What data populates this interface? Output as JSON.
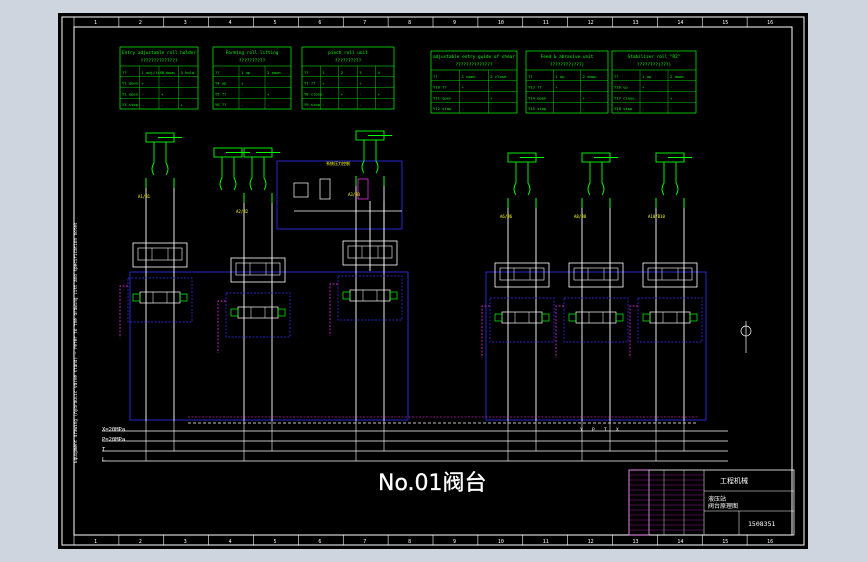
{
  "drawing": {
    "title": "No.01阀台",
    "ruler_numbers": [
      "1",
      "2",
      "3",
      "4",
      "5",
      "6",
      "7",
      "8",
      "9",
      "10",
      "11",
      "12",
      "13",
      "14",
      "15",
      "16"
    ],
    "side_note": "Equipment drawing (hydraulic valve stand) — refer to the drawing list and specification notes",
    "title_block": {
      "company": "工程机械",
      "drawing_no": "1508351",
      "name_lines": [
        "液压站",
        "阀台原理图"
      ]
    }
  },
  "tables": [
    {
      "title": "Entry adjustable roll holder",
      "subtitle": "??????????????",
      "rows": [
        [
          "??",
          "1 adj/lift",
          "2 down",
          "3 hold"
        ],
        [
          "Y1 down",
          "+",
          "-",
          "-"
        ],
        [
          "Y2 open",
          "-",
          "+",
          "-"
        ],
        [
          "Y3 stop",
          "-",
          "-",
          "+"
        ]
      ]
    },
    {
      "title": "Forming roll lifting",
      "subtitle": "??????????",
      "rows": [
        [
          "??",
          "1 up",
          "2 down"
        ],
        [
          "Y4 up",
          "+",
          "-"
        ],
        [
          "Y5 ??",
          "-",
          "+"
        ],
        [
          "Y6 ??",
          "-",
          "-"
        ]
      ]
    },
    {
      "title": "pinch roll unit",
      "subtitle": "??????????",
      "rows": [
        [
          "??",
          "1",
          "2",
          "3",
          "4"
        ],
        [
          "Y7 ??",
          "+",
          "-",
          "+",
          "-"
        ],
        [
          "Y8 close",
          "-",
          "+",
          "-",
          "+"
        ],
        [
          "Y9 stop",
          "-",
          "-",
          "-",
          "-"
        ]
      ]
    },
    {
      "title": "adjustable entry guide of shear",
      "subtitle": "??????????????",
      "rows": [
        [
          "??",
          "1 open",
          "2 close"
        ],
        [
          "Y10 ??",
          "+",
          "-"
        ],
        [
          "Y11 open",
          "-",
          "+"
        ],
        [
          "Y12 stop",
          "-",
          "-"
        ]
      ]
    },
    {
      "title": "Feed & abrasive unit",
      "subtitle": "????????(???)",
      "rows": [
        [
          "??",
          "1 up",
          "2 down"
        ],
        [
          "Y13 ??",
          "+",
          "-"
        ],
        [
          "Y14 open",
          "-",
          "+"
        ],
        [
          "Y15 stop",
          "-",
          "-"
        ]
      ]
    },
    {
      "title": "Stabilizer roll \"R2\"",
      "subtitle": "????????(???)",
      "rows": [
        [
          "??",
          "1 up",
          "2 down"
        ],
        [
          "Y16 up",
          "+",
          "-"
        ],
        [
          "Y17 close",
          "-",
          "+"
        ],
        [
          "Y18 stop",
          "-",
          "-"
        ]
      ]
    }
  ],
  "circuits": {
    "left_port_labels": [
      "A1/B1",
      "A2/B2",
      "A3/B3",
      "A4/B4",
      "A5/B5"
    ],
    "right_port_labels": [
      "A6/B6",
      "A7/B7",
      "A8/B8",
      "A9/B9",
      "A10/B10",
      "A11/B11"
    ],
    "center_labels": [
      "P",
      "T"
    ],
    "bottom_labels": [
      "Y",
      "P",
      "T",
      "X"
    ],
    "subsystem_label": "系统压力控制"
  },
  "supply_lines": {
    "X": "X=20MPa",
    "P": "P=20MPa",
    "T": "T",
    "L": "L"
  },
  "colors": {
    "background": "#000000",
    "hydraulic_line": "#ffffff",
    "cylinder": "#00ff00",
    "table": "#00ff00",
    "pilot_box": "#3333ff",
    "drain": "#ff33ff",
    "text_yellow": "#ffff00",
    "frame": "#ffffff"
  }
}
